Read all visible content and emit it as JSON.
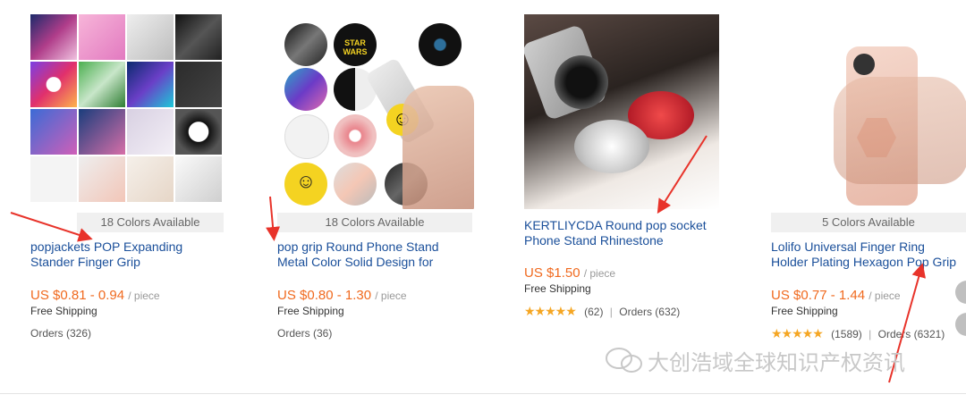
{
  "products": [
    {
      "colors": "18 Colors Available",
      "title": "popjackets POP Expanding\nStander Finger Grip",
      "price": "US $0.81 - 0.94",
      "unit": "/ piece",
      "shipping": "Free Shipping",
      "orders": "Orders (326)"
    },
    {
      "colors": "18 Colors Available",
      "title": "pop grip Round Phone Stand\nMetal Color Solid Design for",
      "price": "US $0.80 - 1.30",
      "unit": "/ piece",
      "shipping": "Free Shipping",
      "orders": "Orders (36)"
    },
    {
      "title": "KERTLIYCDA Round pop socket\nPhone Stand Rhinestone",
      "price": "US $1.50",
      "unit": "/ piece",
      "shipping": "Free Shipping",
      "rating": "★★★★★",
      "reviews": "(62)",
      "separator": "|",
      "orders": "Orders (632)"
    },
    {
      "colors": "5 Colors Available",
      "title": "Lolifo Universal Finger Ring\nHolder Plating Hexagon Pop Grip",
      "price": "US $0.77 - 1.44",
      "unit": "/ piece",
      "shipping": "Free Shipping",
      "rating": "★★★★★",
      "reviews": "(1589)",
      "separator": "|",
      "orders": "Orders (6321)"
    }
  ],
  "watermark": "大创浩域全球知识产权资讯",
  "colors": {
    "title": "#1a4f9a",
    "price": "#f06a1f",
    "star": "#f5a623",
    "arrow": "#e8332a"
  }
}
